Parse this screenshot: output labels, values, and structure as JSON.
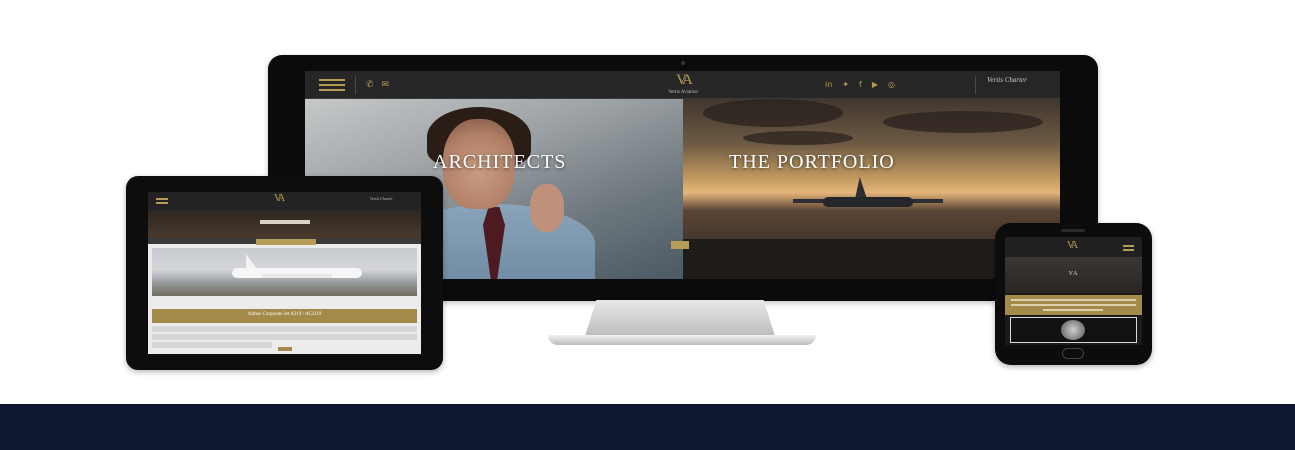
{
  "colors": {
    "gold_accent": "#b79c55",
    "footer_band": "#0f1630",
    "background": "#ffffff",
    "header_dark": "#262626"
  },
  "desktop": {
    "logo_mark": "VA",
    "logo_text": "Vertis Aviation",
    "brand_right": "Vertis Charter",
    "social_icons": [
      "linkedin-icon",
      "twitter-icon",
      "facebook-icon",
      "youtube-icon",
      "instagram-icon"
    ],
    "panels": [
      {
        "title": "ARCHITECTS"
      },
      {
        "title": "THE PORTFOLIO"
      }
    ]
  },
  "tablet": {
    "title_bar_text": "Airbus Corporate Jet A319 / ACJ319"
  },
  "phone": {
    "hero_text": "VA"
  }
}
